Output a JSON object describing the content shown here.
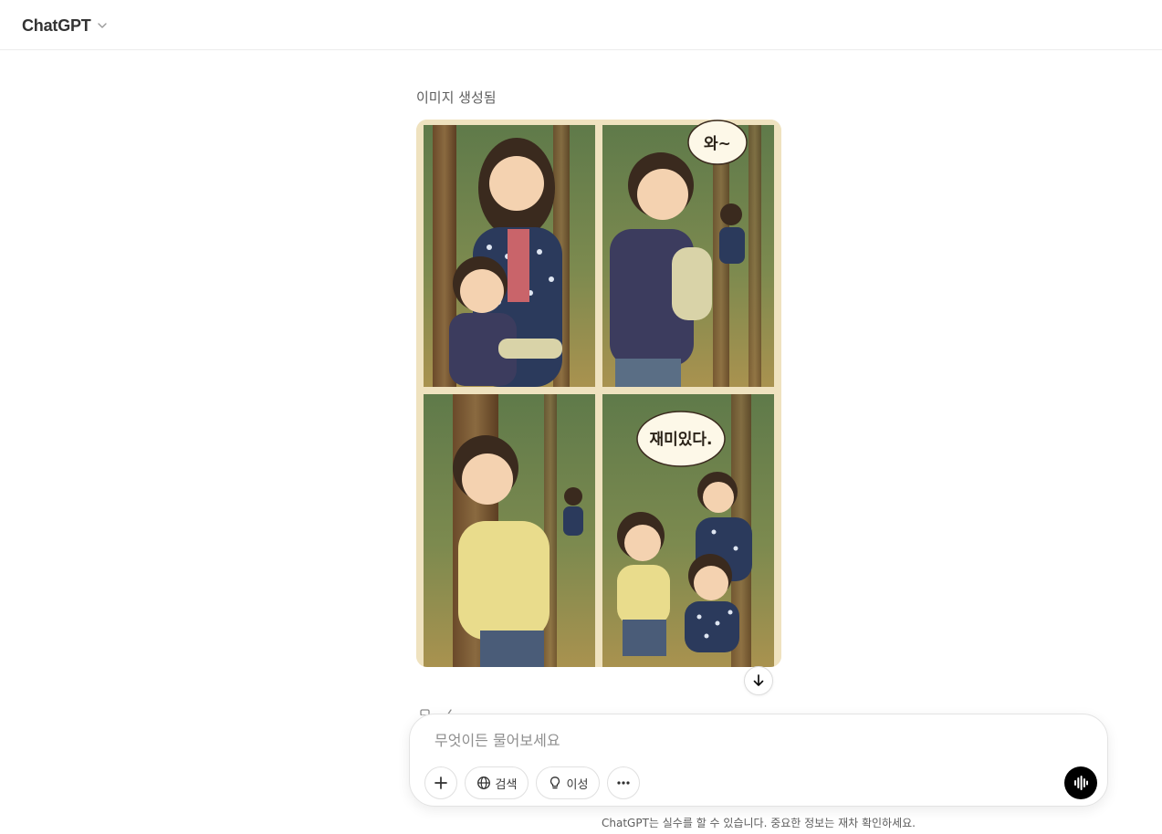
{
  "header": {
    "model_name": "ChatGPT",
    "model_menu_icon": "chevron-down-icon"
  },
  "message": {
    "status": "이미지 생성됨",
    "image": {
      "description_icon": "comic-image",
      "speech_bubble_1": "와~",
      "speech_bubble_2": "재미있다."
    }
  },
  "scroll_down_icon": "arrow-down-icon",
  "composer": {
    "placeholder": "무엇이든 물어보세요",
    "plus_icon": "plus-icon",
    "search_label": "검색",
    "search_icon": "globe-icon",
    "reason_label": "이성",
    "reason_icon": "lightbulb-icon",
    "more_icon": "ellipsis-icon",
    "voice_icon": "voice-waveform-icon"
  },
  "footer": {
    "disclaimer": "ChatGPT는 실수를 할 수 있습니다. 중요한 정보는 재차 확인하세요."
  },
  "colors": {
    "border": "#e3e3e3",
    "muted_text": "#5d5d5d",
    "placeholder": "#8f8f8f",
    "voice_button": "#000000"
  }
}
